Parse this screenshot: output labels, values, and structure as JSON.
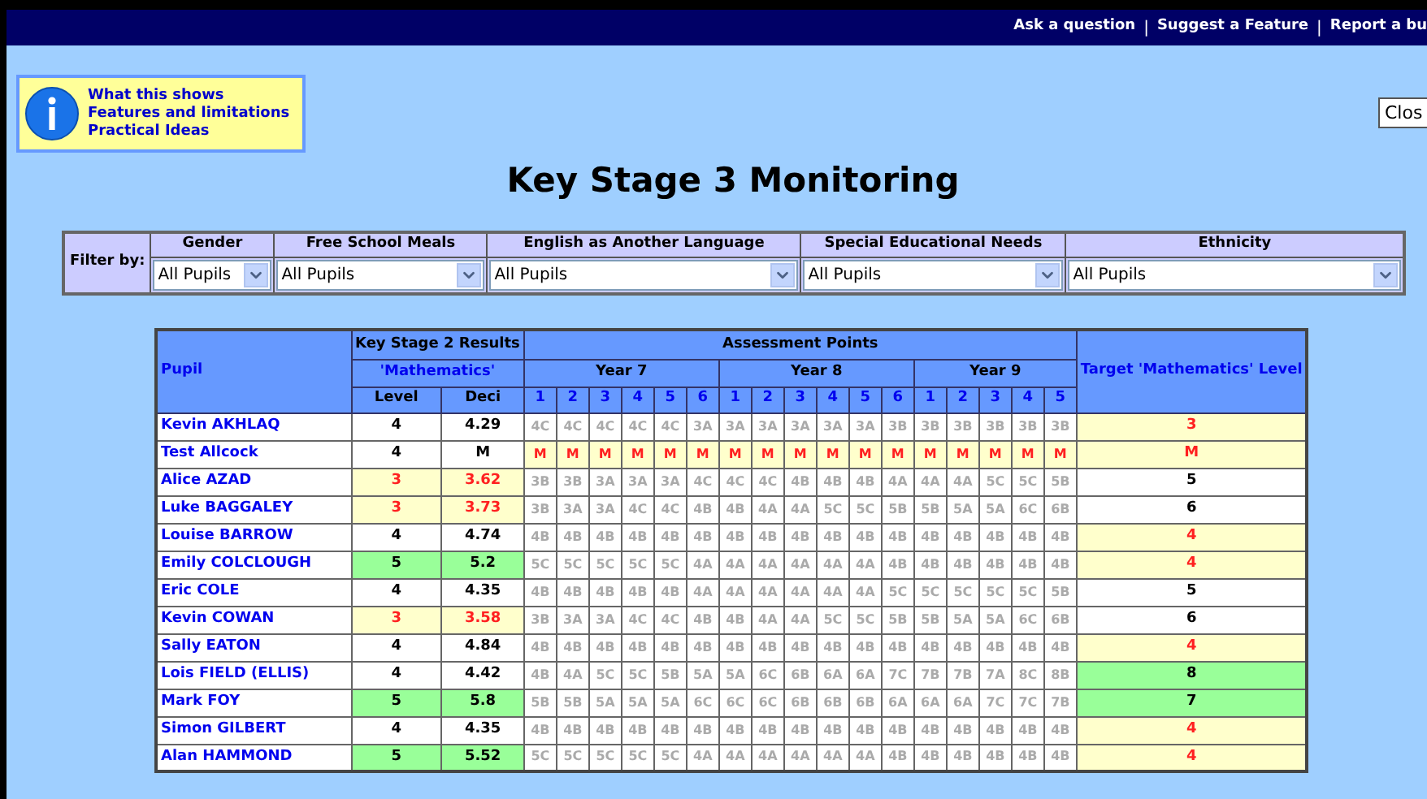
{
  "top_links": [
    "Ask a question",
    "Suggest a Feature",
    "Report a bu"
  ],
  "link_separator": "|",
  "info_links": [
    "What this shows",
    "Features and limitations",
    "Practical Ideas"
  ],
  "close_button": "Clos",
  "title": "Key Stage 3 Monitoring",
  "filter": {
    "label": "Filter by:",
    "filters": [
      {
        "name": "Gender",
        "value": "All Pupils"
      },
      {
        "name": "Free School Meals",
        "value": "All Pupils"
      },
      {
        "name": "English as Another Language",
        "value": "All Pupils"
      },
      {
        "name": "Special Educational Needs",
        "value": "All Pupils"
      },
      {
        "name": "Ethnicity",
        "value": "All Pupils"
      }
    ]
  },
  "table": {
    "pupil_header": "Pupil",
    "ks2_header": "Key Stage 2 Results",
    "subject": "'Mathematics'",
    "level_header": "Level",
    "deci_header": "Deci",
    "assessment_header": "Assessment Points",
    "target_header": "Target 'Mathematics' Level",
    "years": [
      {
        "label": "Year 7",
        "points": [
          "1",
          "2",
          "3",
          "4",
          "5",
          "6"
        ]
      },
      {
        "label": "Year 8",
        "points": [
          "1",
          "2",
          "3",
          "4",
          "5",
          "6"
        ]
      },
      {
        "label": "Year 9",
        "points": [
          "1",
          "2",
          "3",
          "4",
          "5"
        ]
      }
    ],
    "rows": [
      {
        "pupil": "Kevin AKHLAQ",
        "ks2_level": "4",
        "ks2_deci": "4.29",
        "ks2_below": false,
        "ks2_above": false,
        "missing": false,
        "points": [
          "4C",
          "4C",
          "4C",
          "4C",
          "4C",
          "3A",
          "3A",
          "3A",
          "3A",
          "3A",
          "3A",
          "3B",
          "3B",
          "3B",
          "3B",
          "3B",
          "3B"
        ],
        "target": "3",
        "target_below": true,
        "target_above": false
      },
      {
        "pupil": "Test Allcock",
        "ks2_level": "4",
        "ks2_deci": "M",
        "ks2_below": false,
        "ks2_above": false,
        "missing": true,
        "points": [
          "M",
          "M",
          "M",
          "M",
          "M",
          "M",
          "M",
          "M",
          "M",
          "M",
          "M",
          "M",
          "M",
          "M",
          "M",
          "M",
          "M"
        ],
        "target": "M",
        "target_below": true,
        "target_above": false
      },
      {
        "pupil": "Alice AZAD",
        "ks2_level": "3",
        "ks2_deci": "3.62",
        "ks2_below": true,
        "ks2_above": false,
        "missing": false,
        "points": [
          "3B",
          "3B",
          "3A",
          "3A",
          "3A",
          "4C",
          "4C",
          "4C",
          "4B",
          "4B",
          "4B",
          "4A",
          "4A",
          "4A",
          "5C",
          "5C",
          "5B"
        ],
        "target": "5",
        "target_below": false,
        "target_above": false
      },
      {
        "pupil": "Luke BAGGALEY",
        "ks2_level": "3",
        "ks2_deci": "3.73",
        "ks2_below": true,
        "ks2_above": false,
        "missing": false,
        "points": [
          "3B",
          "3A",
          "3A",
          "4C",
          "4C",
          "4B",
          "4B",
          "4A",
          "4A",
          "5C",
          "5C",
          "5B",
          "5B",
          "5A",
          "5A",
          "6C",
          "6B"
        ],
        "target": "6",
        "target_below": false,
        "target_above": false
      },
      {
        "pupil": "Louise BARROW",
        "ks2_level": "4",
        "ks2_deci": "4.74",
        "ks2_below": false,
        "ks2_above": false,
        "missing": false,
        "points": [
          "4B",
          "4B",
          "4B",
          "4B",
          "4B",
          "4B",
          "4B",
          "4B",
          "4B",
          "4B",
          "4B",
          "4B",
          "4B",
          "4B",
          "4B",
          "4B",
          "4B"
        ],
        "target": "4",
        "target_below": true,
        "target_above": false
      },
      {
        "pupil": "Emily COLCLOUGH",
        "ks2_level": "5",
        "ks2_deci": "5.2",
        "ks2_below": false,
        "ks2_above": true,
        "missing": false,
        "points": [
          "5C",
          "5C",
          "5C",
          "5C",
          "5C",
          "4A",
          "4A",
          "4A",
          "4A",
          "4A",
          "4A",
          "4B",
          "4B",
          "4B",
          "4B",
          "4B",
          "4B"
        ],
        "target": "4",
        "target_below": true,
        "target_above": false
      },
      {
        "pupil": "Eric COLE",
        "ks2_level": "4",
        "ks2_deci": "4.35",
        "ks2_below": false,
        "ks2_above": false,
        "missing": false,
        "points": [
          "4B",
          "4B",
          "4B",
          "4B",
          "4B",
          "4A",
          "4A",
          "4A",
          "4A",
          "4A",
          "4A",
          "5C",
          "5C",
          "5C",
          "5C",
          "5C",
          "5B"
        ],
        "target": "5",
        "target_below": false,
        "target_above": false
      },
      {
        "pupil": "Kevin COWAN",
        "ks2_level": "3",
        "ks2_deci": "3.58",
        "ks2_below": true,
        "ks2_above": false,
        "missing": false,
        "points": [
          "3B",
          "3A",
          "3A",
          "4C",
          "4C",
          "4B",
          "4B",
          "4A",
          "4A",
          "5C",
          "5C",
          "5B",
          "5B",
          "5A",
          "5A",
          "6C",
          "6B"
        ],
        "target": "6",
        "target_below": false,
        "target_above": false
      },
      {
        "pupil": "Sally EATON",
        "ks2_level": "4",
        "ks2_deci": "4.84",
        "ks2_below": false,
        "ks2_above": false,
        "missing": false,
        "points": [
          "4B",
          "4B",
          "4B",
          "4B",
          "4B",
          "4B",
          "4B",
          "4B",
          "4B",
          "4B",
          "4B",
          "4B",
          "4B",
          "4B",
          "4B",
          "4B",
          "4B"
        ],
        "target": "4",
        "target_below": true,
        "target_above": false
      },
      {
        "pupil": "Lois FIELD (ELLIS)",
        "ks2_level": "4",
        "ks2_deci": "4.42",
        "ks2_below": false,
        "ks2_above": false,
        "missing": false,
        "points": [
          "4B",
          "4A",
          "5C",
          "5C",
          "5B",
          "5A",
          "5A",
          "6C",
          "6B",
          "6A",
          "6A",
          "7C",
          "7B",
          "7B",
          "7A",
          "8C",
          "8B"
        ],
        "target": "8",
        "target_below": false,
        "target_above": true
      },
      {
        "pupil": "Mark FOY",
        "ks2_level": "5",
        "ks2_deci": "5.8",
        "ks2_below": false,
        "ks2_above": true,
        "missing": false,
        "points": [
          "5B",
          "5B",
          "5A",
          "5A",
          "5A",
          "6C",
          "6C",
          "6C",
          "6B",
          "6B",
          "6B",
          "6A",
          "6A",
          "6A",
          "7C",
          "7C",
          "7B"
        ],
        "target": "7",
        "target_below": false,
        "target_above": true
      },
      {
        "pupil": "Simon GILBERT",
        "ks2_level": "4",
        "ks2_deci": "4.35",
        "ks2_below": false,
        "ks2_above": false,
        "missing": false,
        "points": [
          "4B",
          "4B",
          "4B",
          "4B",
          "4B",
          "4B",
          "4B",
          "4B",
          "4B",
          "4B",
          "4B",
          "4B",
          "4B",
          "4B",
          "4B",
          "4B",
          "4B"
        ],
        "target": "4",
        "target_below": true,
        "target_above": false
      },
      {
        "pupil": "Alan HAMMOND",
        "ks2_level": "5",
        "ks2_deci": "5.52",
        "ks2_below": false,
        "ks2_above": true,
        "missing": false,
        "points": [
          "5C",
          "5C",
          "5C",
          "5C",
          "5C",
          "4A",
          "4A",
          "4A",
          "4A",
          "4A",
          "4A",
          "4B",
          "4B",
          "4B",
          "4B",
          "4B",
          "4B"
        ],
        "target": "4",
        "target_below": true,
        "target_above": false
      }
    ]
  }
}
